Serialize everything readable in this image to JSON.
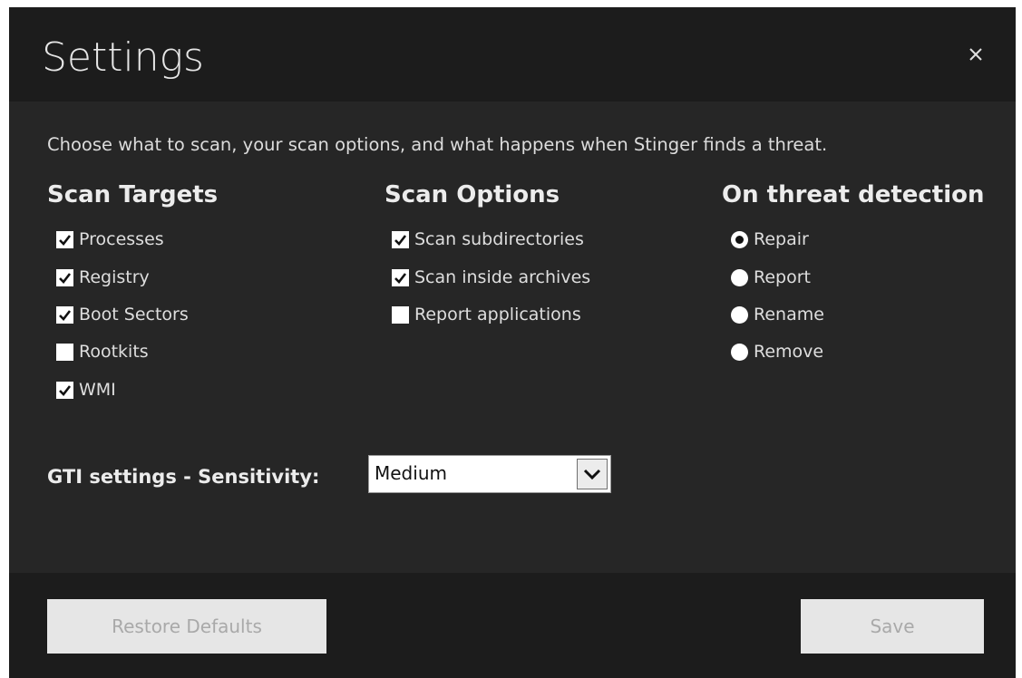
{
  "dialog": {
    "title": "Settings",
    "close_icon": "close-icon"
  },
  "intro_text": "Choose what to scan, your scan options, and what happens when Stinger finds a threat.",
  "scan_targets": {
    "heading": "Scan Targets",
    "items": [
      {
        "label": "Processes",
        "checked": true
      },
      {
        "label": "Registry",
        "checked": true
      },
      {
        "label": "Boot Sectors",
        "checked": true
      },
      {
        "label": "Rootkits",
        "checked": false
      },
      {
        "label": "WMI",
        "checked": true
      }
    ]
  },
  "scan_options": {
    "heading": "Scan Options",
    "items": [
      {
        "label": "Scan subdirectories",
        "checked": true
      },
      {
        "label": "Scan inside archives",
        "checked": true
      },
      {
        "label": "Report applications",
        "checked": false
      }
    ]
  },
  "threat_detection": {
    "heading": "On threat detection",
    "selected": "Repair",
    "items": [
      {
        "label": "Repair"
      },
      {
        "label": "Report"
      },
      {
        "label": "Rename"
      },
      {
        "label": "Remove"
      }
    ]
  },
  "gti": {
    "label": "GTI settings - Sensitivity:",
    "selected": "Medium"
  },
  "footer": {
    "restore_label": "Restore Defaults",
    "save_label": "Save"
  }
}
